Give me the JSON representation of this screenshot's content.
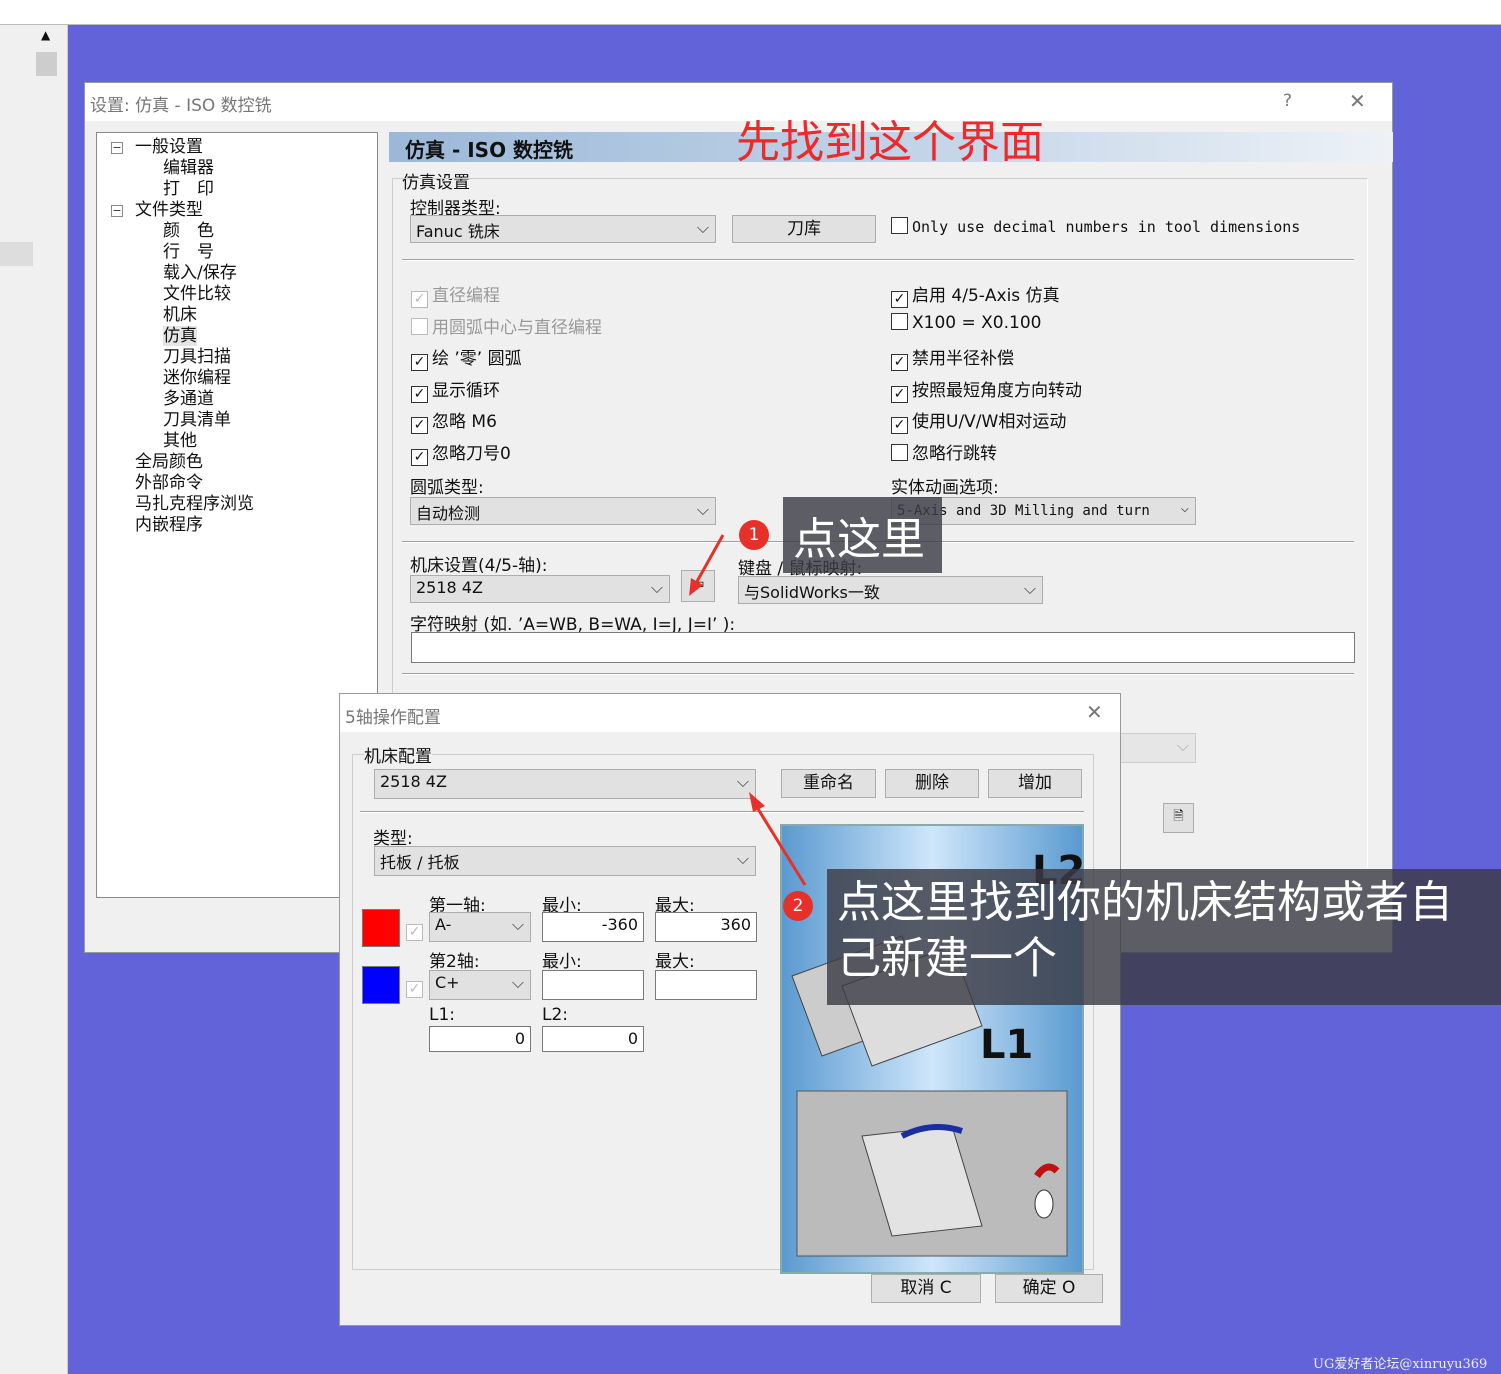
{
  "main_dialog": {
    "title": "设置: 仿真 - ISO 数控铣",
    "help": "?",
    "close": "✕",
    "tree": [
      {
        "label": "一般设置",
        "level": 1,
        "expander": "⊟"
      },
      {
        "label": "编辑器",
        "level": 2
      },
      {
        "label": "打　印",
        "level": 2
      },
      {
        "label": "文件类型",
        "level": 1,
        "expander": "⊟"
      },
      {
        "label": "颜　色",
        "level": 2
      },
      {
        "label": "行　号",
        "level": 2
      },
      {
        "label": "载入/保存",
        "level": 2
      },
      {
        "label": "文件比较",
        "level": 2
      },
      {
        "label": "机床",
        "level": 2
      },
      {
        "label": "仿真",
        "level": 2,
        "selected": true
      },
      {
        "label": "刀具扫描",
        "level": 2
      },
      {
        "label": "迷你编程",
        "level": 2
      },
      {
        "label": "多通道",
        "level": 2
      },
      {
        "label": "刀具清单",
        "level": 2
      },
      {
        "label": "其他",
        "level": 2
      },
      {
        "label": "全局颜色",
        "level": 1
      },
      {
        "label": "外部命令",
        "level": 1
      },
      {
        "label": "马扎克程序浏览",
        "level": 1
      },
      {
        "label": "内嵌程序",
        "level": 1
      }
    ],
    "header": "仿真 - ISO 数控铣",
    "group": "仿真设置",
    "controller_label": "控制器类型:",
    "controller_value": "Fanuc 铣床",
    "tool_lib_button": "刀库",
    "decimal_only": {
      "label": "Only use decimal numbers in tool dimensions",
      "checked": false
    },
    "left_checks": [
      {
        "label": "直径编程",
        "checked": true,
        "disabled": true
      },
      {
        "label": "用圆弧中心与直径编程",
        "checked": false,
        "disabled": true
      },
      {
        "label": "绘 ’零’ 圆弧",
        "checked": true
      },
      {
        "label": "显示循环",
        "checked": true
      },
      {
        "label": "忽略 M6",
        "checked": true
      },
      {
        "label": "忽略刀号0",
        "checked": true
      }
    ],
    "right_checks": [
      {
        "label": "启用 4/5-Axis 仿真",
        "checked": true
      },
      {
        "label": "X100 = X0.100",
        "checked": false
      },
      {
        "label": "禁用半径补偿",
        "checked": true
      },
      {
        "label": "按照最短角度方向转动",
        "checked": true
      },
      {
        "label": "使用U/V/W相对运动",
        "checked": true
      },
      {
        "label": "忽略行跳转",
        "checked": false
      }
    ],
    "arc_type_label": "圆弧类型:",
    "arc_type_value": "自动检测",
    "solid_anim_label": "实体动画选项:",
    "solid_anim_value": "5-Axis and 3D Milling and turn",
    "machine_label": "机床设置(4/5-轴):",
    "machine_value": "2518 4Z",
    "kbd_label": "键盘 / 鼠标映射:",
    "kbd_value": "与SolidWorks一致",
    "charmap_label": "字符映射 (如. ’A=WB, B=WA, I=J, J=I’ ):",
    "charmap_value": ""
  },
  "axis_dialog": {
    "title": "5轴操作配置",
    "close": "✕",
    "group": "机床配置",
    "config_value": "2518 4Z",
    "rename": "重命名",
    "delete": "删除",
    "add": "增加",
    "type_label": "类型:",
    "type_value": "托板 / 托板",
    "axis1_label": "第一轴:",
    "axis1_value": "A-",
    "axis1_color": "#ff0000",
    "min_label": "最小:",
    "max_label": "最大:",
    "axis1_min": "-360",
    "axis1_max": "360",
    "axis2_label": "第2轴:",
    "axis2_value": "C+",
    "axis2_color": "#0000ff",
    "axis2_min": "",
    "axis2_max": "",
    "l1_label": "L1:",
    "l1_value": "0",
    "l2_label": "L2:",
    "l2_value": "0",
    "diagram_l1": "L1",
    "diagram_l2": "L2",
    "cancel": "取消 C",
    "ok": "确定 O"
  },
  "annotations": {
    "top": "先找到这个界面",
    "step1_num": "1",
    "step1": "点这里",
    "step2_num": "2",
    "step2": "点这里找到你的机床结构或者自己新建一个"
  },
  "watermark": "UG爱好者论坛@xinruyu369"
}
